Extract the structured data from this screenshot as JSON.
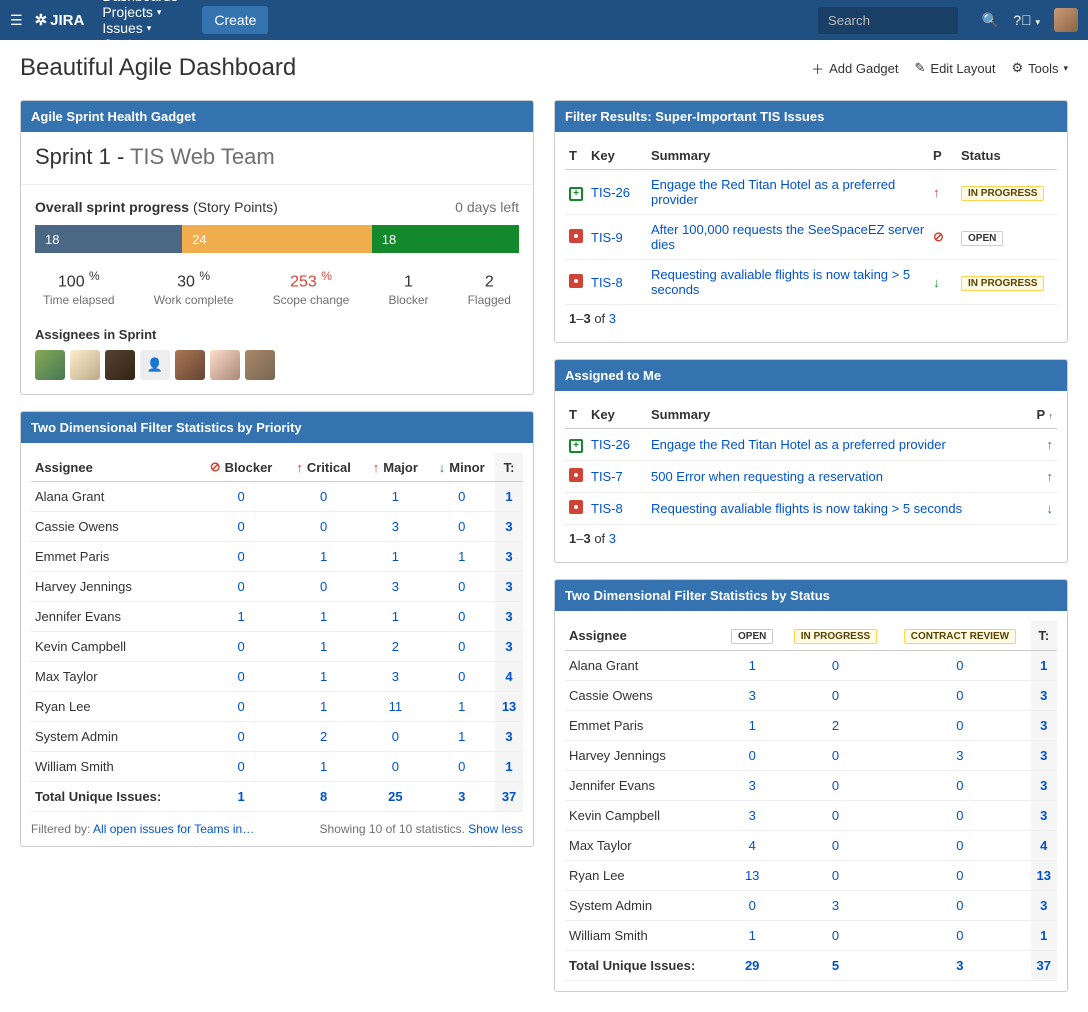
{
  "nav": {
    "logo": "JIRA",
    "items": [
      "Dashboards",
      "Projects",
      "Issues",
      "Capture"
    ],
    "create": "Create",
    "search_placeholder": "Search"
  },
  "page": {
    "title": "Beautiful Agile Dashboard",
    "actions": {
      "add_gadget": "Add Gadget",
      "edit_layout": "Edit Layout",
      "tools": "Tools"
    }
  },
  "sprint_health": {
    "title": "Agile Sprint Health Gadget",
    "sprint_name": "Sprint 1",
    "team": "TIS Web Team",
    "overall_label": "Overall sprint progress",
    "story_points": "(Story Points)",
    "days_left": "0 days left",
    "bar": {
      "done": "18",
      "in_progress": "24",
      "todo": "18"
    },
    "metrics": [
      {
        "val": "100",
        "pct": "%",
        "label": "Time elapsed"
      },
      {
        "val": "30",
        "pct": "%",
        "label": "Work complete"
      },
      {
        "val": "253",
        "pct": "%",
        "label": "Scope change",
        "red": true
      },
      {
        "val": "1",
        "pct": "",
        "label": "Blocker"
      },
      {
        "val": "2",
        "pct": "",
        "label": "Flagged"
      }
    ],
    "assignees_title": "Assignees in Sprint"
  },
  "filter_results": {
    "title": "Filter Results: Super-Important TIS Issues",
    "cols": {
      "t": "T",
      "key": "Key",
      "summary": "Summary",
      "p": "P",
      "status": "Status"
    },
    "rows": [
      {
        "t": "story",
        "key": "TIS-26",
        "summary": "Engage the Red Titan Hotel as a preferred provider",
        "p": "up",
        "status": "IN PROGRESS",
        "status_cls": "loz-prog"
      },
      {
        "t": "bug",
        "key": "TIS-9",
        "summary": "After 100,000 requests the SeeSpaceEZ server dies",
        "p": "block",
        "status": "OPEN",
        "status_cls": "loz-open"
      },
      {
        "t": "bug",
        "key": "TIS-8",
        "summary": "Requesting avaliable flights is now taking > 5 seconds",
        "p": "down",
        "status": "IN PROGRESS",
        "status_cls": "loz-prog"
      }
    ],
    "pager_a": "1",
    "pager_b": "3",
    "pager_of": "of",
    "pager_n": "3"
  },
  "assigned": {
    "title": "Assigned to Me",
    "cols": {
      "t": "T",
      "key": "Key",
      "summary": "Summary",
      "p": "P"
    },
    "rows": [
      {
        "t": "story",
        "key": "TIS-26",
        "summary": "Engage the Red Titan Hotel as a preferred provider",
        "p": "up"
      },
      {
        "t": "bug",
        "key": "TIS-7",
        "summary": "500 Error when requesting a reservation",
        "p": "up"
      },
      {
        "t": "bug",
        "key": "TIS-8",
        "summary": "Requesting avaliable flights is now taking > 5 seconds",
        "p": "down"
      }
    ],
    "pager_a": "1",
    "pager_b": "3",
    "pager_of": "of",
    "pager_n": "3"
  },
  "stats_priority": {
    "title": "Two Dimensional Filter Statistics by Priority",
    "assignee_col": "Assignee",
    "cols": [
      {
        "icon": "block",
        "label": "Blocker"
      },
      {
        "icon": "up",
        "label": "Critical"
      },
      {
        "icon": "up",
        "label": "Major"
      },
      {
        "icon": "down",
        "label": "Minor"
      }
    ],
    "t_col": "T:",
    "rows": [
      {
        "name": "Alana Grant",
        "v": [
          "0",
          "0",
          "1",
          "0"
        ],
        "t": "1"
      },
      {
        "name": "Cassie Owens",
        "v": [
          "0",
          "0",
          "3",
          "0"
        ],
        "t": "3"
      },
      {
        "name": "Emmet Paris",
        "v": [
          "0",
          "1",
          "1",
          "1"
        ],
        "t": "3"
      },
      {
        "name": "Harvey Jennings",
        "v": [
          "0",
          "0",
          "3",
          "0"
        ],
        "t": "3"
      },
      {
        "name": "Jennifer Evans",
        "v": [
          "1",
          "1",
          "1",
          "0"
        ],
        "t": "3"
      },
      {
        "name": "Kevin Campbell",
        "v": [
          "0",
          "1",
          "2",
          "0"
        ],
        "t": "3"
      },
      {
        "name": "Max Taylor",
        "v": [
          "0",
          "1",
          "3",
          "0"
        ],
        "t": "4"
      },
      {
        "name": "Ryan Lee",
        "v": [
          "0",
          "1",
          "11",
          "1"
        ],
        "t": "13"
      },
      {
        "name": "System Admin",
        "v": [
          "0",
          "2",
          "0",
          "1"
        ],
        "t": "3"
      },
      {
        "name": "William Smith",
        "v": [
          "0",
          "1",
          "0",
          "0"
        ],
        "t": "1"
      }
    ],
    "total_label": "Total Unique Issues:",
    "totals": [
      "1",
      "8",
      "25",
      "3"
    ],
    "total_t": "37",
    "filtered_label": "Filtered by:",
    "filtered_link": "All open issues for Teams in…",
    "showing": "Showing 10 of 10 statistics.",
    "show_less": "Show less"
  },
  "stats_status": {
    "title": "Two Dimensional Filter Statistics by Status",
    "assignee_col": "Assignee",
    "cols": [
      {
        "label": "OPEN",
        "cls": "loz-open"
      },
      {
        "label": "IN PROGRESS",
        "cls": "loz-prog"
      },
      {
        "label": "CONTRACT REVIEW",
        "cls": "loz-review"
      }
    ],
    "t_col": "T:",
    "rows": [
      {
        "name": "Alana Grant",
        "v": [
          "1",
          "0",
          "0"
        ],
        "t": "1"
      },
      {
        "name": "Cassie Owens",
        "v": [
          "3",
          "0",
          "0"
        ],
        "t": "3"
      },
      {
        "name": "Emmet Paris",
        "v": [
          "1",
          "2",
          "0"
        ],
        "t": "3"
      },
      {
        "name": "Harvey Jennings",
        "v": [
          "0",
          "0",
          "3"
        ],
        "t": "3"
      },
      {
        "name": "Jennifer Evans",
        "v": [
          "3",
          "0",
          "0"
        ],
        "t": "3"
      },
      {
        "name": "Kevin Campbell",
        "v": [
          "3",
          "0",
          "0"
        ],
        "t": "3"
      },
      {
        "name": "Max Taylor",
        "v": [
          "4",
          "0",
          "0"
        ],
        "t": "4"
      },
      {
        "name": "Ryan Lee",
        "v": [
          "13",
          "0",
          "0"
        ],
        "t": "13"
      },
      {
        "name": "System Admin",
        "v": [
          "0",
          "3",
          "0"
        ],
        "t": "3"
      },
      {
        "name": "William Smith",
        "v": [
          "1",
          "0",
          "0"
        ],
        "t": "1"
      }
    ],
    "total_label": "Total Unique Issues:",
    "totals": [
      "29",
      "5",
      "3"
    ],
    "total_t": "37"
  }
}
